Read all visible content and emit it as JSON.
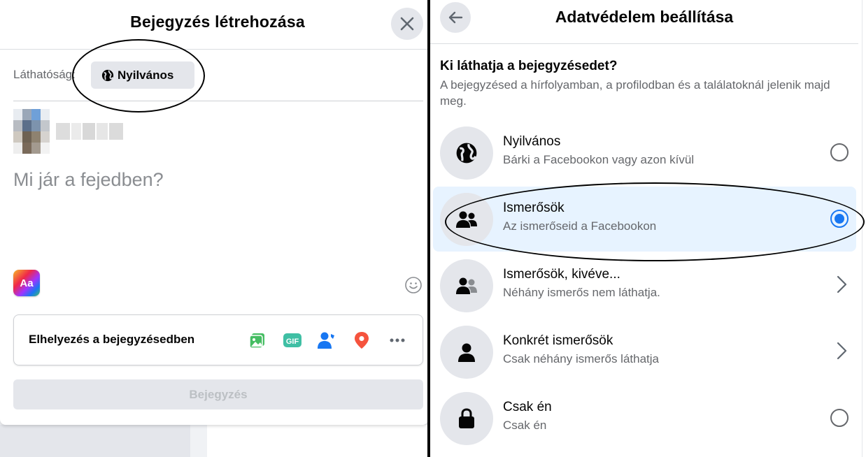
{
  "create_post": {
    "title": "Bejegyzés létrehozása",
    "visibility_label": "Láthatóság:",
    "visibility_value": "Nyilvános",
    "composer_placeholder": "Mi jár a fejedben?",
    "aa_label": "Aa",
    "add_to_post": "Elhelyezés a bejegyzésedben",
    "add_icons": [
      "photo-video-icon",
      "gif-icon",
      "tag-people-icon",
      "location-icon",
      "more-icon"
    ],
    "gif_label": "GIF",
    "post_button": "Bejegyzés"
  },
  "privacy": {
    "title": "Adatvédelem beállítása",
    "question": "Ki láthatja a bejegyzésedet?",
    "description": "A bejegyzésed a hírfolyamban, a profilodban és a találatoknál jelenik majd meg.",
    "options": [
      {
        "name": "Nyilvános",
        "desc": "Bárki a Facebookon vagy azon kívül",
        "icon": "globe-icon",
        "control": "radio",
        "selected": false
      },
      {
        "name": "Ismerősök",
        "desc": "Az ismerőseid a Facebookon",
        "icon": "friends-icon",
        "control": "radio",
        "selected": true
      },
      {
        "name": "Ismerősök, kivéve...",
        "desc": "Néhány ismerős nem láthatja.",
        "icon": "friends-except-icon",
        "control": "chevron",
        "selected": false
      },
      {
        "name": "Konkrét ismerősök",
        "desc": "Csak néhány ismerős láthatja",
        "icon": "person-icon",
        "control": "chevron",
        "selected": false
      },
      {
        "name": "Csak én",
        "desc": "Csak én",
        "icon": "lock-icon",
        "control": "radio",
        "selected": false
      }
    ]
  },
  "colors": {
    "accent": "#1877f2",
    "selected_bg": "#e7f3ff",
    "secondary_text": "#65676b",
    "button_bg": "#e4e6eb"
  }
}
